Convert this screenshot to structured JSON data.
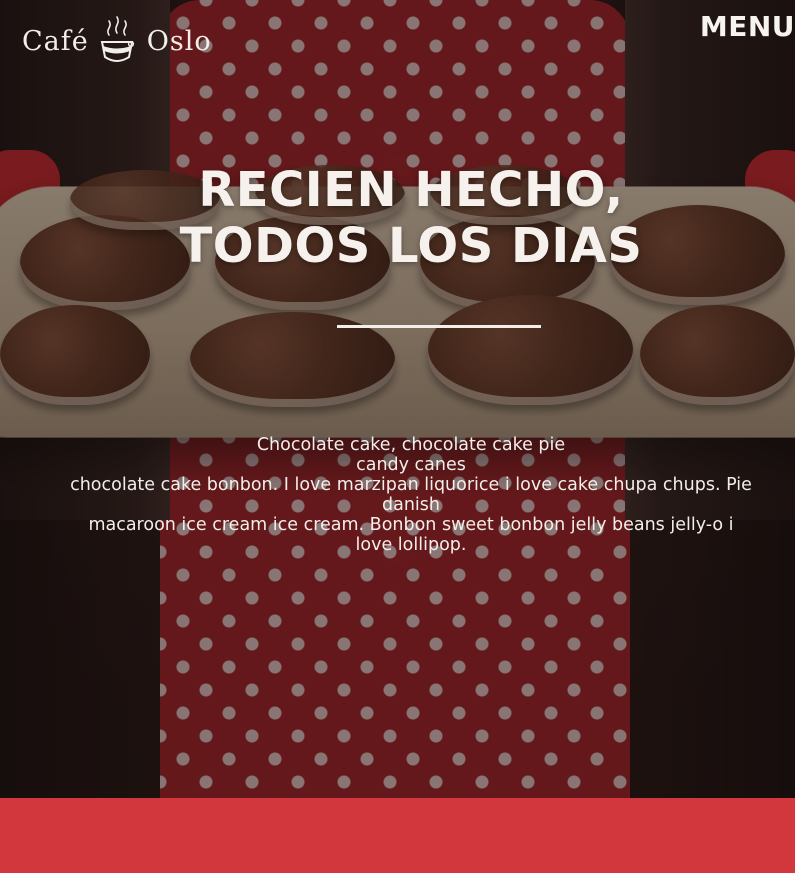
{
  "header": {
    "logo_left": "Café",
    "logo_right": "Oslo",
    "menu_label": "MENU"
  },
  "hero": {
    "headline_line1": "RECIEN HECHO,",
    "headline_line2": "TODOS LOS DIAS",
    "paragraph_lines": [
      "Chocolate cake, chocolate cake pie",
      "candy canes",
      "chocolate cake bonbon. I love marzipan liquorice i love cake chupa chups. Pie",
      "danish",
      "macaroon ice cream ice cream. Bonbon sweet bonbon jelly beans jelly-o i",
      "love lollipop."
    ]
  },
  "colors": {
    "accent_red": "#d1373d",
    "text_light": "#f2eeea"
  },
  "icons": {
    "logo_icon": "coffee-cup-icon"
  }
}
